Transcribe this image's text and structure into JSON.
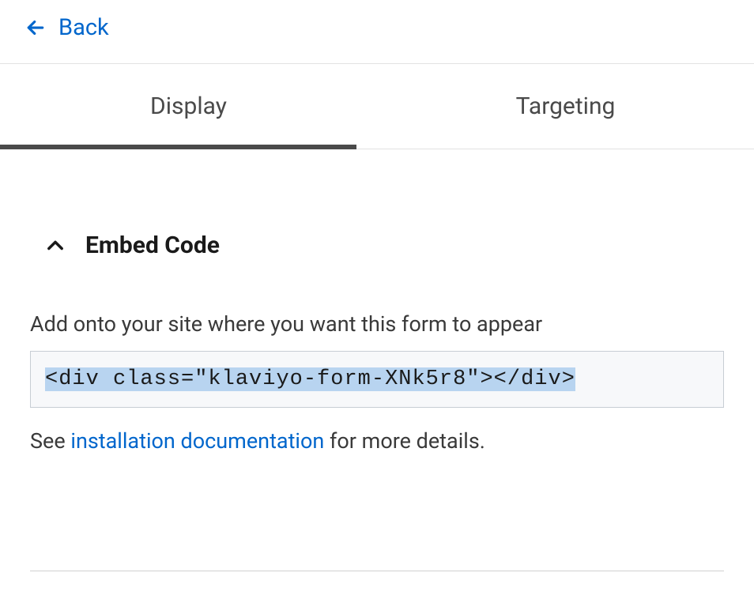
{
  "nav": {
    "back_label": "Back"
  },
  "tabs": {
    "display": "Display",
    "targeting": "Targeting"
  },
  "section": {
    "title": "Embed Code",
    "instruction": "Add onto your site where you want this form to appear",
    "code": "<div class=\"klaviyo-form-XNk5r8\"></div>",
    "help_prefix": "See ",
    "help_link": "installation documentation",
    "help_suffix": " for more details."
  }
}
